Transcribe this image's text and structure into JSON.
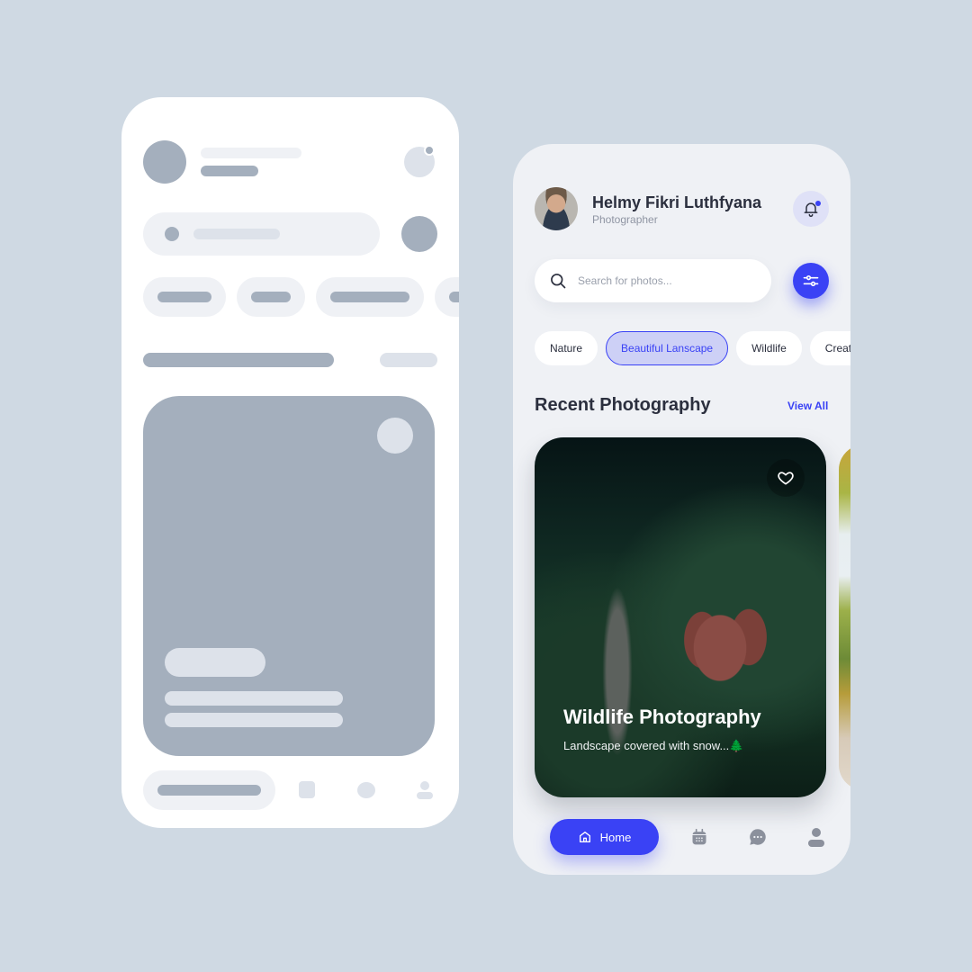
{
  "colors": {
    "background": "#cfd9e3",
    "accent": "#3a42f5",
    "chip_active_bg": "#cdd0f6",
    "text_primary": "#2b2f3e",
    "text_secondary": "#8f95a3",
    "wireframe_dark": "#a4afbd",
    "wireframe_light": "#eff1f5"
  },
  "wireframe": {
    "description": "Skeleton loading state of the photography app"
  },
  "app": {
    "header": {
      "user_name": "Helmy Fikri Luthfyana",
      "user_role": "Photographer",
      "avatar_icon": "user-avatar-photo",
      "notification_icon": "bell-icon",
      "has_unread_notification": true
    },
    "search": {
      "placeholder": "Search for photos...",
      "value": "",
      "icon": "search-icon",
      "filter_icon": "sliders-icon"
    },
    "categories": [
      {
        "label": "Nature",
        "active": false
      },
      {
        "label": "Beautiful Lanscape",
        "active": true
      },
      {
        "label": "Wildlife",
        "active": false
      },
      {
        "label": "Creative",
        "active": false
      }
    ],
    "section": {
      "title": "Recent Photography",
      "view_all": "View All"
    },
    "cards": [
      {
        "title": "Wildlife Photography",
        "subtitle": "Landscape covered with snow...",
        "subtitle_emoji": "🌲",
        "image": "elephant-in-forest-photo",
        "favorite_icon": "heart-icon"
      },
      {
        "title": "",
        "image": "tropical-palm-trees-photo"
      }
    ],
    "bottom_nav": {
      "items": [
        {
          "label": "Home",
          "icon": "home-icon",
          "active": true
        },
        {
          "label": "",
          "icon": "calendar-icon",
          "active": false
        },
        {
          "label": "",
          "icon": "chat-icon",
          "active": false
        },
        {
          "label": "",
          "icon": "profile-icon",
          "active": false
        }
      ]
    }
  }
}
